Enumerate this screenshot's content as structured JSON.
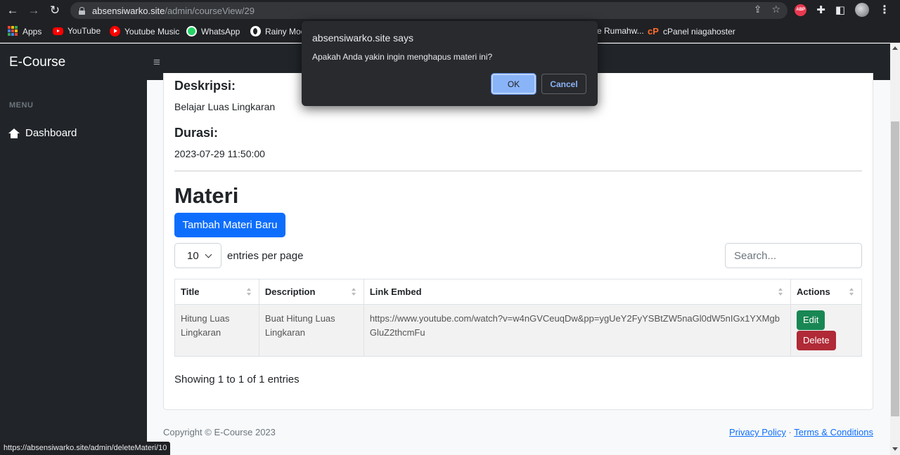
{
  "browser": {
    "url_host": "absensiwarko.site",
    "url_path": "/admin/courseView/29",
    "status_url": "https://absensiwarko.site/admin/deleteMateri/10",
    "bookmarks": [
      {
        "label": "Apps",
        "icon": "apps-grid-icon"
      },
      {
        "label": "YouTube",
        "icon": "youtube-icon"
      },
      {
        "label": "Youtube Music",
        "icon": "youtube-music-icon"
      },
      {
        "label": "WhatsApp",
        "icon": "whatsapp-icon"
      },
      {
        "label": "Rainy Moc",
        "icon": "rainy-mood-icon"
      },
      {
        "label": "e Rumahw...",
        "icon": ""
      },
      {
        "label": "cPanel niagahoster",
        "icon": "cpanel-icon"
      }
    ]
  },
  "dialog": {
    "title": "absensiwarko.site says",
    "message": "Apakah Anda yakin ingin menghapus materi ini?",
    "ok_label": "OK",
    "cancel_label": "Cancel"
  },
  "app": {
    "brand": "E-Course",
    "toggle_icon": "≡",
    "sidebar": {
      "heading": "MENU",
      "items": [
        {
          "label": "Dashboard",
          "icon": "home-icon"
        }
      ]
    }
  },
  "course": {
    "desc_label": "Deskripsi:",
    "desc_value": "Belajar Luas Lingkaran",
    "duration_label": "Durasi:",
    "duration_value": "2023-07-29 11:50:00"
  },
  "materi": {
    "title": "Materi",
    "add_button": "Tambah Materi Baru",
    "per_page_value": "10",
    "per_page_label": "entries per page",
    "search_placeholder": "Search...",
    "columns": [
      "Title",
      "Description",
      "Link Embed",
      "Actions"
    ],
    "rows": [
      {
        "title": "Hitung Luas Lingkaran",
        "description": "Buat Hitung Luas Lingkaran",
        "link": "https://www.youtube.com/watch?v=w4nGVCeuqDw&pp=ygUeY2FyYSBtZW5naGl0dW5nIGx1YXMgbGluZ2thcmFu",
        "edit_label": "Edit",
        "delete_label": "Delete"
      }
    ],
    "info": "Showing 1 to 1 of 1 entries"
  },
  "footer": {
    "copyright": "Copyright © E-Course 2023",
    "privacy": "Privacy Policy",
    "separator": "·",
    "terms": "Terms & Conditions"
  },
  "colors": {
    "primary": "#0d6efd",
    "success": "#198754",
    "danger": "#b02a37",
    "dark": "#212529"
  }
}
